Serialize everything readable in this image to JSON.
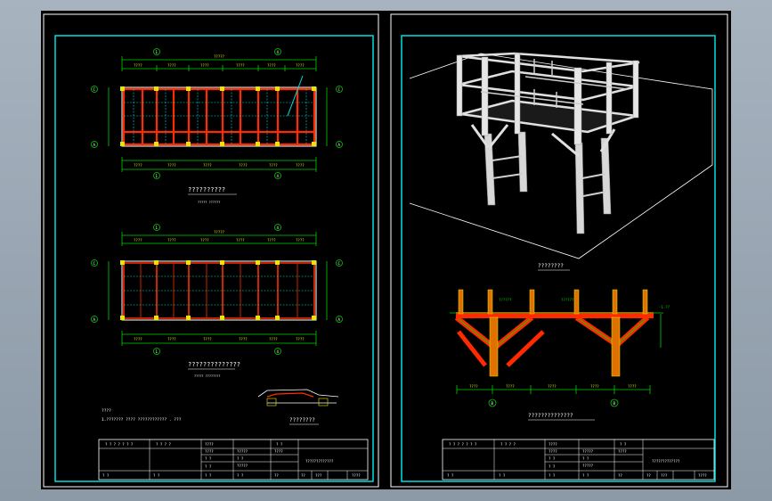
{
  "sheet1": {
    "plan1_title": "??????????",
    "plan1_subtitle": "????? ??????",
    "plan2_title": "??????????????",
    "plan2_subtitle": "????? ????????",
    "detail_title": "????????",
    "notes_heading": "????",
    "notes_line": "1.??????? ???? ???????????? . ???",
    "axis_letters": [
      "C",
      "A"
    ],
    "axis_numbers": [
      "1",
      "4"
    ],
    "titleblock": {
      "r1": [
        "? ? ? ? ? ? ?",
        "? ? ? ?",
        "????",
        "? ?"
      ],
      "r2": [
        "????",
        "?????",
        "????"
      ],
      "r3": [
        "? ?",
        "? ?",
        "?????"
      ],
      "r4": [
        "? ?",
        "? ?",
        "? ?",
        "? ?",
        "? ?"
      ],
      "drawing_name": "?????????????",
      "footer": [
        "??",
        "??",
        "???",
        "????"
      ]
    }
  },
  "sheet2": {
    "iso_title": "????????",
    "section_title": "??????????????",
    "axis_label": "B",
    "titleblock": {
      "r1": [
        "? ? ? ? ? ? ?",
        "? ? ? ?",
        "????",
        "? ?"
      ],
      "r2": [
        "????",
        "?????",
        "????"
      ],
      "r3": [
        "? ?",
        "? ?",
        "?????"
      ],
      "r4": [
        "? ?",
        "? ?",
        "? ?",
        "? ?",
        "? ?"
      ],
      "drawing_name": "?????????????",
      "footer": [
        "??",
        "??",
        "???",
        "????"
      ]
    }
  },
  "colors": {
    "background": "#000000",
    "frame": "#00e0e0",
    "green": "#00d000",
    "red": "#ff2a00",
    "yellow": "#e8e800",
    "white": "#ffffff"
  }
}
